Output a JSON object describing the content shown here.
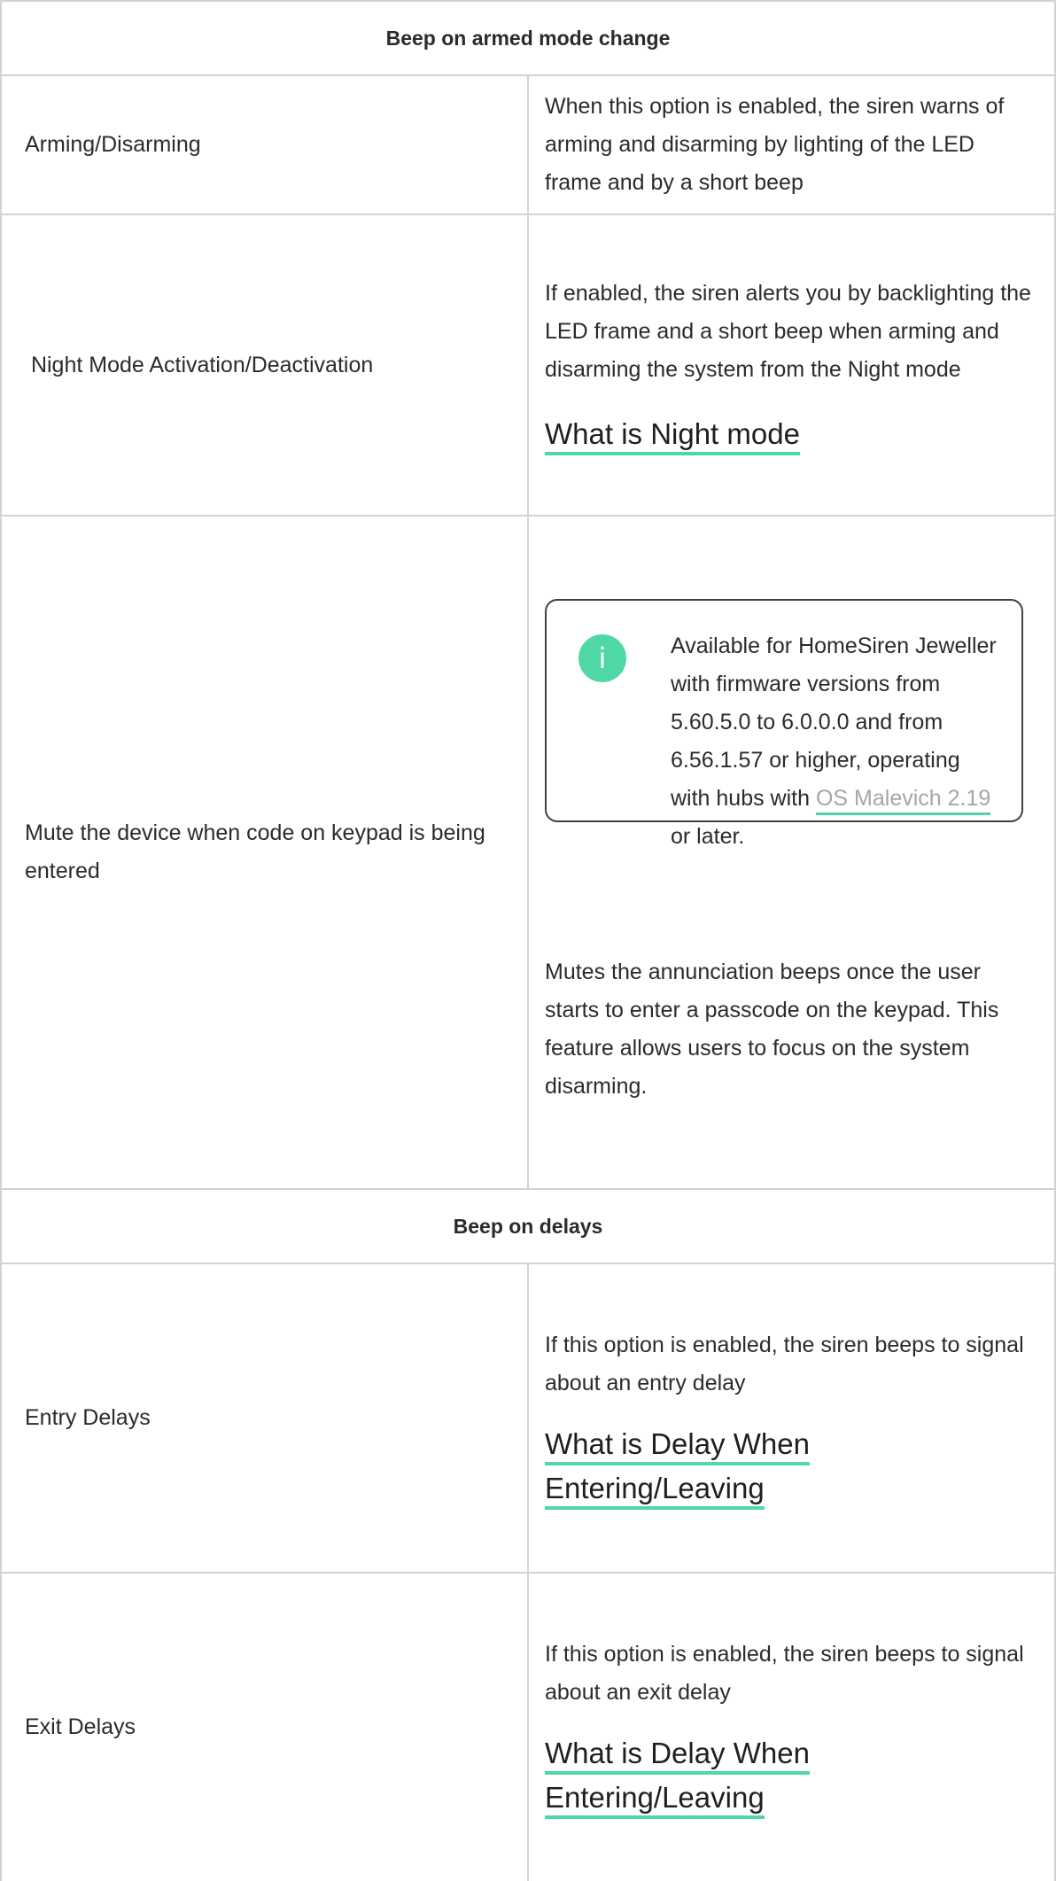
{
  "sections": {
    "armed_mode": {
      "title": "Beep on armed mode change"
    },
    "delays": {
      "title": "Beep on delays"
    }
  },
  "rows": {
    "arming": {
      "label": "Arming/Disarming",
      "description": "When this option is enabled, the siren warns of arming and disarming by lighting of the LED frame and by a short beep"
    },
    "night": {
      "label": " Night Mode Activation/Deactivation",
      "description": "If enabled, the siren alerts you by backlighting the LED frame and a short beep when arming and disarming the system from the Night mode",
      "link": "What is Night mode"
    },
    "mute": {
      "label": "Mute the device when code on keypad is being entered",
      "notice": {
        "icon": "info-icon",
        "icon_glyph": "i",
        "text_before": "Available for HomeSiren Jeweller with firmware versions from 5.60.5.0 to 6.0.0.0 and from 6.56.1.57 or higher, operating with hubs with ",
        "link": "OS Malevich 2.19",
        "text_after": " or later."
      },
      "description": "Mutes the annunciation beeps once the user starts to enter a passcode on the keypad. This feature allows users to focus on the system disarming."
    },
    "entry": {
      "label": "Entry Delays",
      "description": "If this option is enabled, the siren beeps to signal about an entry delay",
      "link": "What is Delay When Entering/Leaving"
    },
    "exit": {
      "label": "Exit Delays",
      "description": "If this option is enabled, the siren beeps to signal about an exit delay",
      "link": "What is Delay When Entering/Leaving"
    }
  },
  "colors": {
    "accent": "#4fd8a6",
    "border": "#d2d2d2",
    "text": "#2b2b2b",
    "inline_link": "#a6a6a6"
  }
}
